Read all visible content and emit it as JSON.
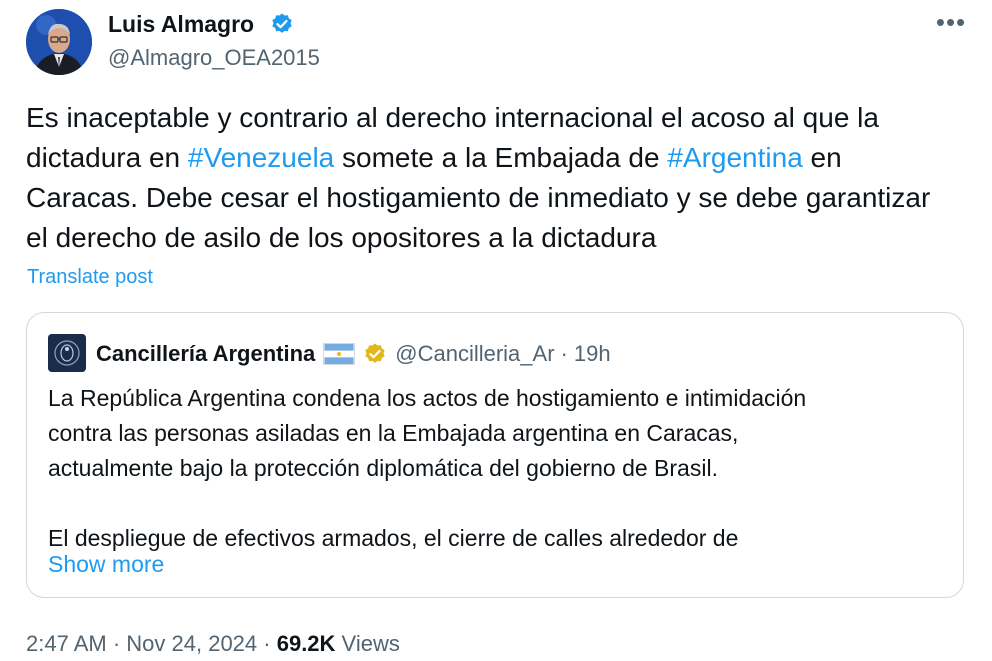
{
  "author": {
    "name": "Luis Almagro",
    "handle": "@Almagro_OEA2015",
    "verified": "blue-verified-icon"
  },
  "more_icon": "more-horizontal-icon",
  "post": {
    "lines": [
      [
        {
          "text": "Es inaceptable y contrario al derecho internacional el acoso al que la"
        }
      ],
      [
        {
          "text": "dictadura en "
        },
        {
          "text": "#Venezuela",
          "hashtag": true
        },
        {
          "text": " somete a la Embajada de "
        },
        {
          "text": "#Argentina",
          "hashtag": true
        },
        {
          "text": " en"
        }
      ],
      [
        {
          "text": "Caracas. Debe cesar el hostigamiento de inmediato y se debe garantizar"
        }
      ],
      [
        {
          "text": "el derecho de asilo de los opositores a la dictadura"
        }
      ]
    ],
    "translate_label": "Translate post"
  },
  "quote": {
    "name": "Cancillería Argentina",
    "flag": "argentina-flag",
    "verified": "gold-verified-icon",
    "handle": "@Cancilleria_Ar",
    "separator": "·",
    "time": "19h",
    "lines": [
      "La República Argentina condena los actos de hostigamiento e intimidación",
      "contra las personas asiladas en la Embajada argentina en Caracas,",
      "actualmente bajo la protección diplomática del gobierno de Brasil.",
      "",
      "El despliegue de efectivos armados, el cierre de calles alrededor de"
    ],
    "show_more": "Show more"
  },
  "meta": {
    "time": "2:47 AM",
    "sep1": " · ",
    "date": "Nov 24, 2024",
    "sep2": " · ",
    "views_count": "69.2K",
    "views_label": " Views"
  },
  "colors": {
    "link": "#1d9bf0",
    "text": "#0f1419",
    "muted": "#536471",
    "border": "#cfd9de"
  }
}
